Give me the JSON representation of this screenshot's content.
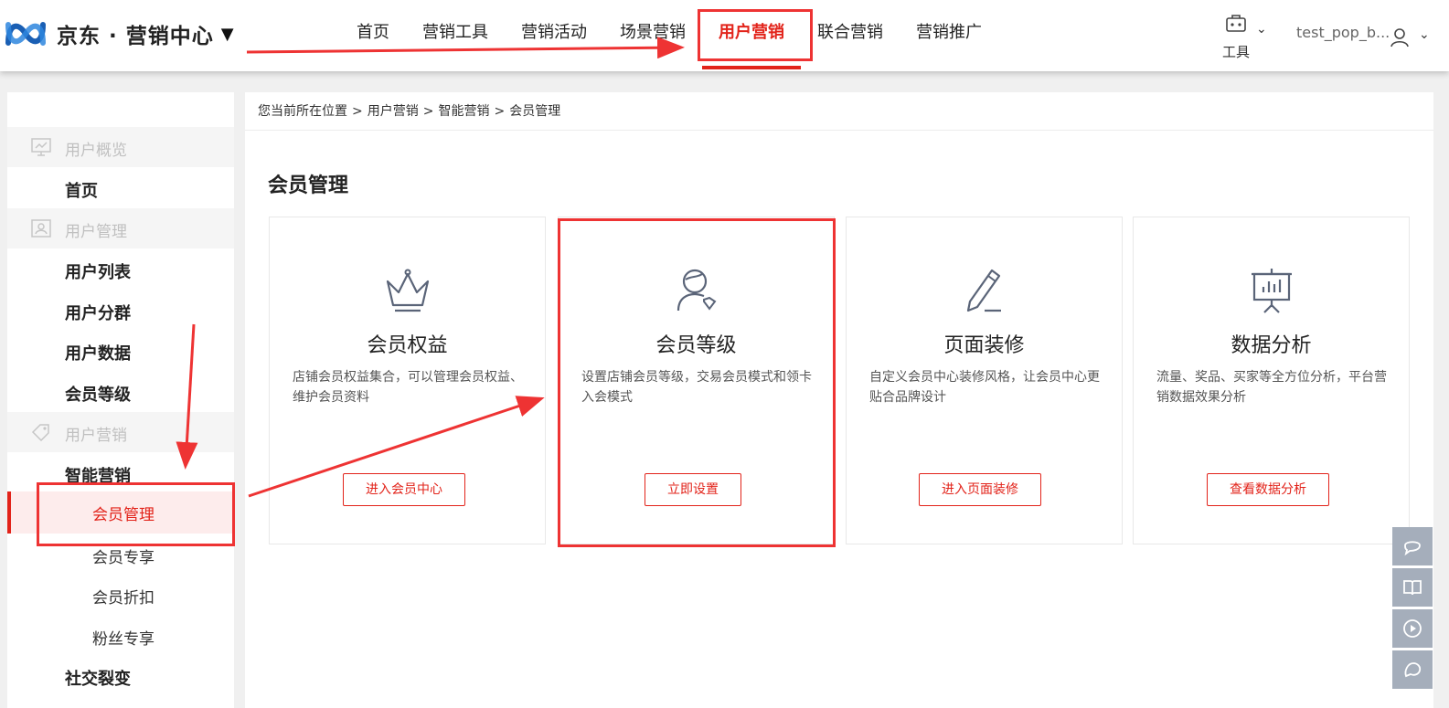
{
  "brand": {
    "name": "京东 · 营销中心",
    "caret": "▼"
  },
  "nav": {
    "items": [
      "首页",
      "营销工具",
      "营销活动",
      "场景营销",
      "用户营销",
      "联合营销",
      "营销推广"
    ],
    "active": "用户营销"
  },
  "header": {
    "tools_label": "工具",
    "username": "test_pop_b...",
    "chevron": "⌄"
  },
  "sidebar": {
    "groups": [
      {
        "label": "用户概览",
        "icon": "dashboard-icon"
      },
      {
        "label": "用户管理",
        "icon": "user-card-icon"
      },
      {
        "label": "用户营销",
        "icon": "tag-icon"
      }
    ],
    "items": {
      "home": "首页",
      "user_list": "用户列表",
      "user_segment": "用户分群",
      "user_data": "用户数据",
      "member_level": "会员等级",
      "smart_marketing": "智能营销",
      "member_manage": "会员管理",
      "member_exclusive": "会员专享",
      "member_discount": "会员折扣",
      "fan_exclusive": "粉丝专享",
      "social_fission": "社交裂变"
    }
  },
  "breadcrumb": {
    "prefix": "您当前所在位置",
    "sep": ">",
    "parts": [
      "用户营销",
      "智能营销",
      "会员管理"
    ]
  },
  "page": {
    "title": "会员管理"
  },
  "cards": [
    {
      "title": "会员权益",
      "desc": "店铺会员权益集合，可以管理会员权益、维护会员资料",
      "button": "进入会员中心",
      "icon": "crown-icon"
    },
    {
      "title": "会员等级",
      "desc": "设置店铺会员等级，交易会员模式和领卡入会模式",
      "button": "立即设置",
      "icon": "member-level-icon"
    },
    {
      "title": "页面装修",
      "desc": "自定义会员中心装修风格，让会员中心更贴合品牌设计",
      "button": "进入页面装修",
      "icon": "pen-icon"
    },
    {
      "title": "数据分析",
      "desc": "流量、奖品、买家等全方位分析，平台营销数据效果分析",
      "button": "查看数据分析",
      "icon": "presentation-chart-icon"
    }
  ],
  "colors": {
    "accent": "#e2231a",
    "annotation": "#ee3333",
    "float_bg": "#a5aebb"
  }
}
